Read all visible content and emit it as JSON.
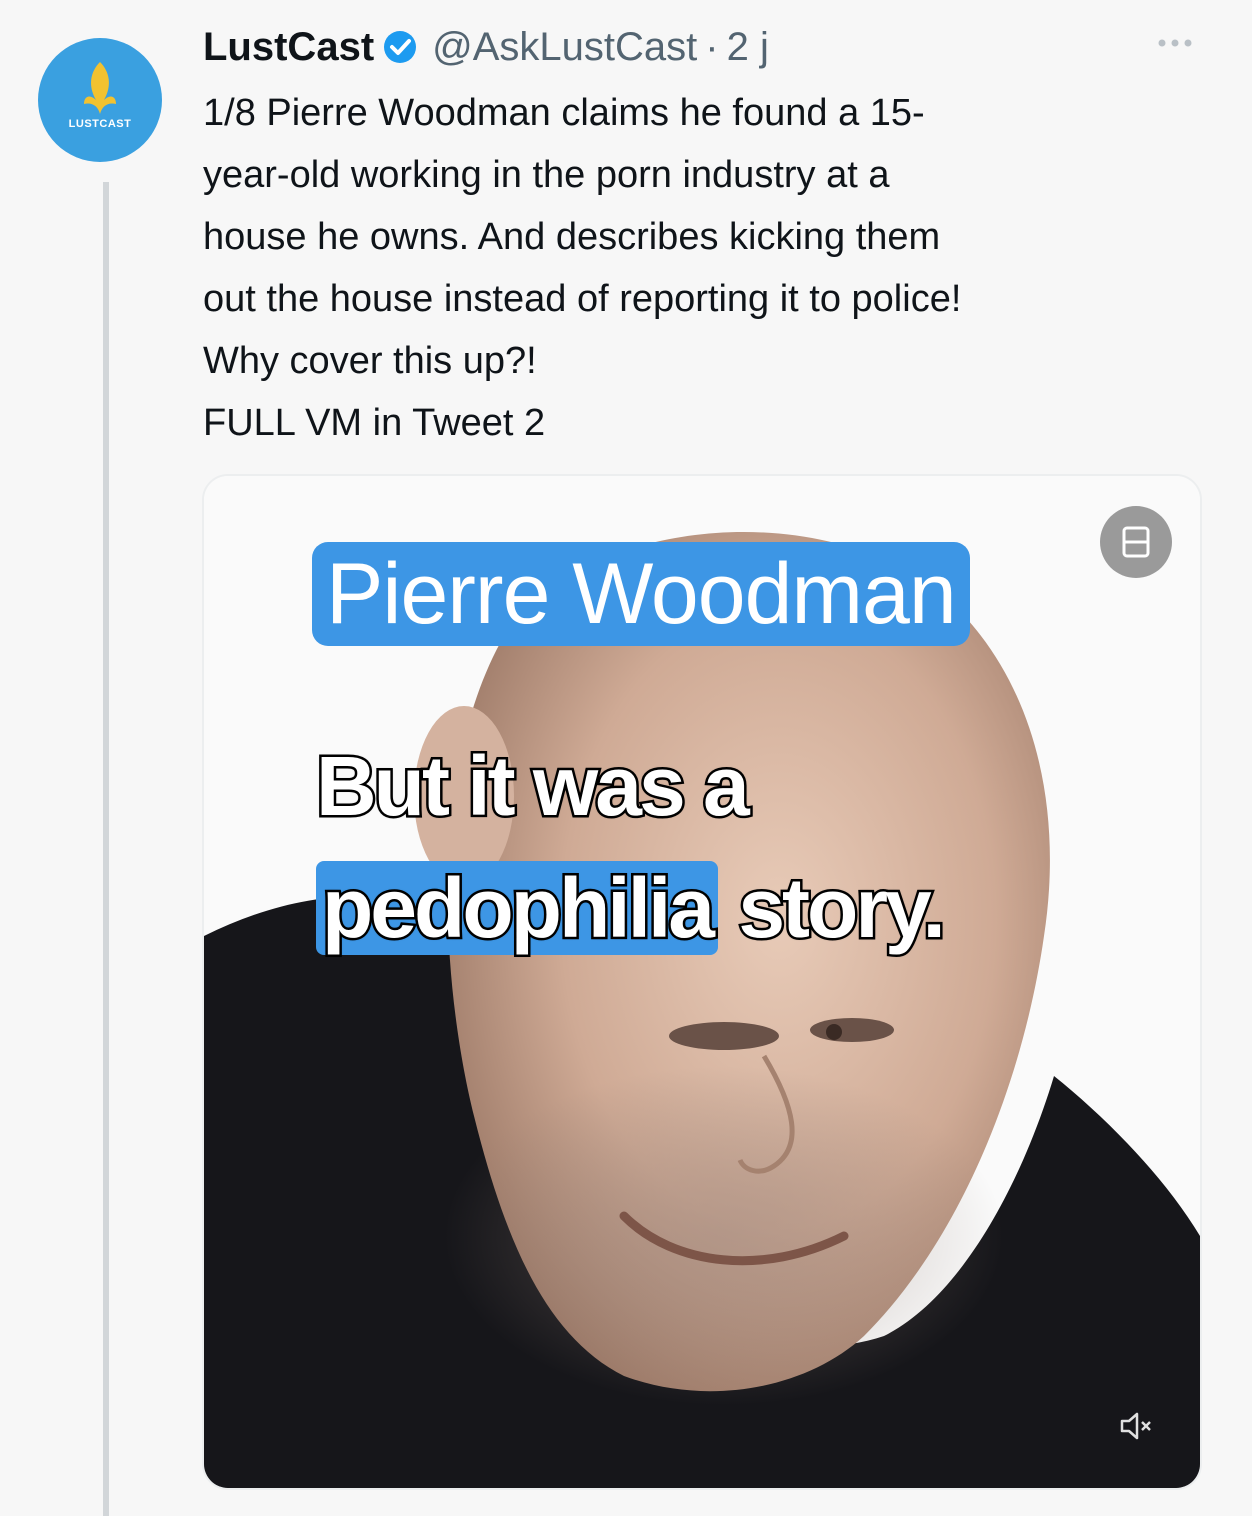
{
  "tweet": {
    "author": {
      "display_name": "LustCast",
      "handle": "@AskLustCast",
      "verified": true,
      "avatar_label": "LUSTCAST"
    },
    "separator": "·",
    "time": "2 j",
    "text_lines": [
      "1/8 Pierre Woodman claims he found a 15-",
      "year-old working in the porn industry at a",
      "house he owns. And describes kicking them",
      "out the house instead of reporting it to police!",
      "Why cover this up?!",
      "FULL VM in Tweet 2"
    ]
  },
  "media": {
    "type": "video",
    "overlay_name": "Pierre Woodman",
    "caption_line1": "But it was a",
    "caption_line2_highlight": "pedophilia",
    "caption_line2_rest": " story.",
    "icons": [
      "gif-badge-icon",
      "mute-icon",
      "more-icon",
      "verified-icon"
    ]
  },
  "colors": {
    "accent": "#3d96e5",
    "avatar_bg": "#3aa0e0",
    "handle": "#536471",
    "thread_line": "#d2d6d9"
  }
}
